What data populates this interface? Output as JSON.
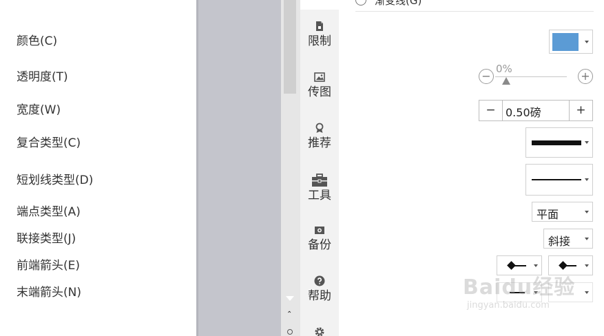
{
  "sidebar": {
    "top_fragment": "...",
    "tools": [
      {
        "icon": "restrict-icon",
        "label": "限制"
      },
      {
        "icon": "image-icon",
        "label": "传图"
      },
      {
        "icon": "award-icon",
        "label": "推荐"
      },
      {
        "icon": "toolbox-icon",
        "label": "工具"
      },
      {
        "icon": "camera-icon",
        "label": "备份"
      },
      {
        "icon": "question-icon",
        "label": "帮助"
      },
      {
        "icon": "gear-icon",
        "label": ""
      }
    ],
    "scroll_up_glyph": "⌃"
  },
  "panel": {
    "top_option": "渐变线(G)",
    "color": {
      "label": "颜色(C)",
      "value": "#5b9bd5"
    },
    "transparency": {
      "label": "透明度(T)",
      "value": "0%",
      "level": 0,
      "minus": "−",
      "plus": "+"
    },
    "width": {
      "label": "宽度(W)",
      "value": "0.50磅",
      "minus": "−",
      "plus": "+"
    },
    "compound_type": {
      "label": "复合类型(C)"
    },
    "dash_type": {
      "label": "短划线类型(D)"
    },
    "cap_type": {
      "label": "端点类型(A)",
      "value": "平面"
    },
    "join_type": {
      "label": "联接类型(J)",
      "value": "斜接"
    },
    "begin_arrow": {
      "label": "前端箭头(E)"
    },
    "end_arrow": {
      "label": "末端箭头(N)"
    }
  },
  "watermark": {
    "big": "Baidu经验",
    "small": "jingyan.baidu.com"
  },
  "colors": {
    "accent": "#5b9bd5",
    "sidebar_bg": "#f2f2f2",
    "doc_gray": "#c4c5cc"
  }
}
